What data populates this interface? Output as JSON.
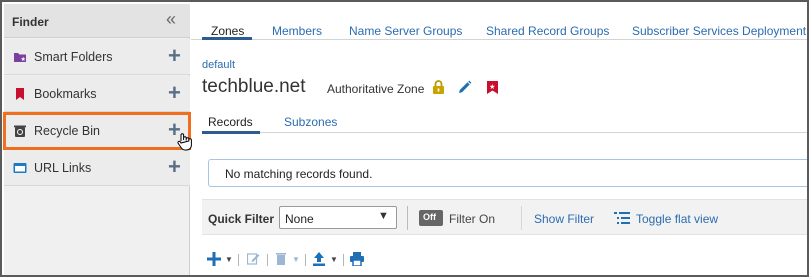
{
  "sidebar": {
    "title": "Finder",
    "items": [
      {
        "label": "Smart Folders",
        "icon": "smart-folder-icon"
      },
      {
        "label": "Bookmarks",
        "icon": "bookmark-icon"
      },
      {
        "label": "Recycle Bin",
        "icon": "recycle-bin-icon"
      },
      {
        "label": "URL Links",
        "icon": "url-link-icon"
      }
    ]
  },
  "tabs": [
    "Zones",
    "Members",
    "Name Server Groups",
    "Shared Record Groups",
    "Subscriber Services Deployment"
  ],
  "breadcrumb": "default",
  "zone": {
    "name": "techblue.net",
    "type": "Authoritative Zone"
  },
  "subtabs": [
    "Records",
    "Subzones"
  ],
  "message": "No matching records found.",
  "filter": {
    "label": "Quick Filter",
    "selected": "None",
    "toggle": "Off",
    "toggle_label": "Filter On",
    "show_filter": "Show Filter",
    "flat_view": "Toggle flat view"
  },
  "colors": {
    "accent": "#2b6cb0",
    "highlight": "#f06f1e",
    "tab_underline": "#2e5b93"
  }
}
